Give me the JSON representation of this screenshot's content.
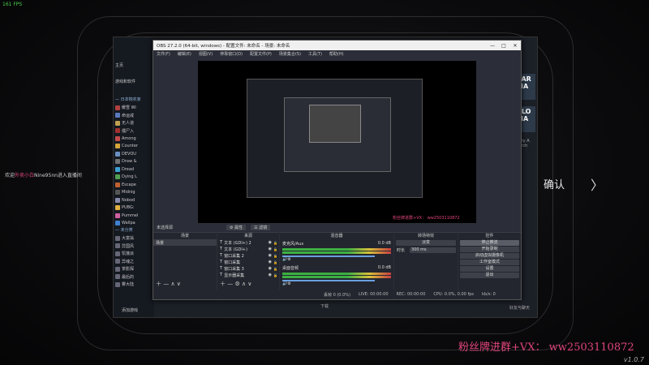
{
  "overlay": {
    "fps": "161 FPS",
    "version": "v1.0.7",
    "promo": "粉丝牌进群+VX： ww2503110872",
    "danmu_prefix": "欢迎",
    "danmu_name": "外卖小白",
    "danmu_text": "Nine95nn进入直播间",
    "confirm": "确认",
    "chevron_left": "〈",
    "chevron_right": "〉"
  },
  "steam": {
    "search_label": "游戏和软件",
    "home_label": "主页",
    "group1": "— 日本物农家",
    "games": [
      "暖雪 Wi",
      "命运戒",
      "无人道",
      "僵尸入",
      "Among",
      "Counter",
      "DEVOU",
      "Draw &",
      "Dread",
      "Dying L",
      "Escape",
      "Midnig",
      "Nobod",
      "PUBG:",
      "Pummel",
      "Wallpa"
    ],
    "game_colors": [
      "#b04040",
      "#5a7abf",
      "#c0a050",
      "#a03030",
      "#c24a4a",
      "#d7a43a",
      "#6a8fbf",
      "#707070",
      "#3ca0d0",
      "#50a050",
      "#c06030",
      "#555555",
      "#8888aa",
      "#e0b040",
      "#d060a0",
      "#4080d0"
    ],
    "group2": "— 未分类",
    "games2": [
      "大富翁",
      "异国风",
      "饥饿派",
      "异魂之",
      "茶影探",
      "最后的",
      "雾大陆"
    ],
    "add_game": "添加游戏",
    "cards": [
      "EAR MA",
      "CLO MA"
    ],
    "card_sub": "Early A March",
    "downloads": "下载",
    "friends": "好友与聊天"
  },
  "obs": {
    "title": "OBS 27.2.0 (64-bit, windows) - 配置文件: 未命名 - 场景: 未命名",
    "menu": [
      "文件(F)",
      "编辑(E)",
      "视图(V)",
      "停靠窗口(D)",
      "配置文件(P)",
      "场景集合(S)",
      "工具(T)",
      "帮助(H)"
    ],
    "source_selected": "未选择源",
    "props_label": "属性",
    "filters_label": "滤镜",
    "scenes_header": "场景",
    "scenes": [
      "场景"
    ],
    "sources_header": "来源",
    "sources": [
      "文本 (GDI+) 2",
      "文本 (GDI+)",
      "窗口采集 2",
      "窗口采集",
      "窗口采集 3",
      "显示器采集"
    ],
    "mixer_header": "混音器",
    "mixer": [
      {
        "name": "麦克风/Aux",
        "db": "0.0 dB"
      },
      {
        "name": "桌面音频",
        "db": "0.0 dB"
      }
    ],
    "transitions_header": "转场特效",
    "transition_type": "淡变",
    "duration_label": "时长",
    "duration_value": "300 ms",
    "controls_header": "控件",
    "controls": [
      "停止推流",
      "开始录制",
      "启动虚拟摄像机",
      "工作室模式",
      "设置",
      "退出"
    ],
    "status": {
      "dropped": "丢帧 0 (0.0%)",
      "live": "LIVE: 00:00:00",
      "rec": "REC: 00:00:00",
      "cpu": "CPU: 0.0%, 0.00 fps",
      "kbps": "kb/s: 0"
    },
    "preview_overlay": "粉丝牌进群+VX： ww2503110872"
  }
}
